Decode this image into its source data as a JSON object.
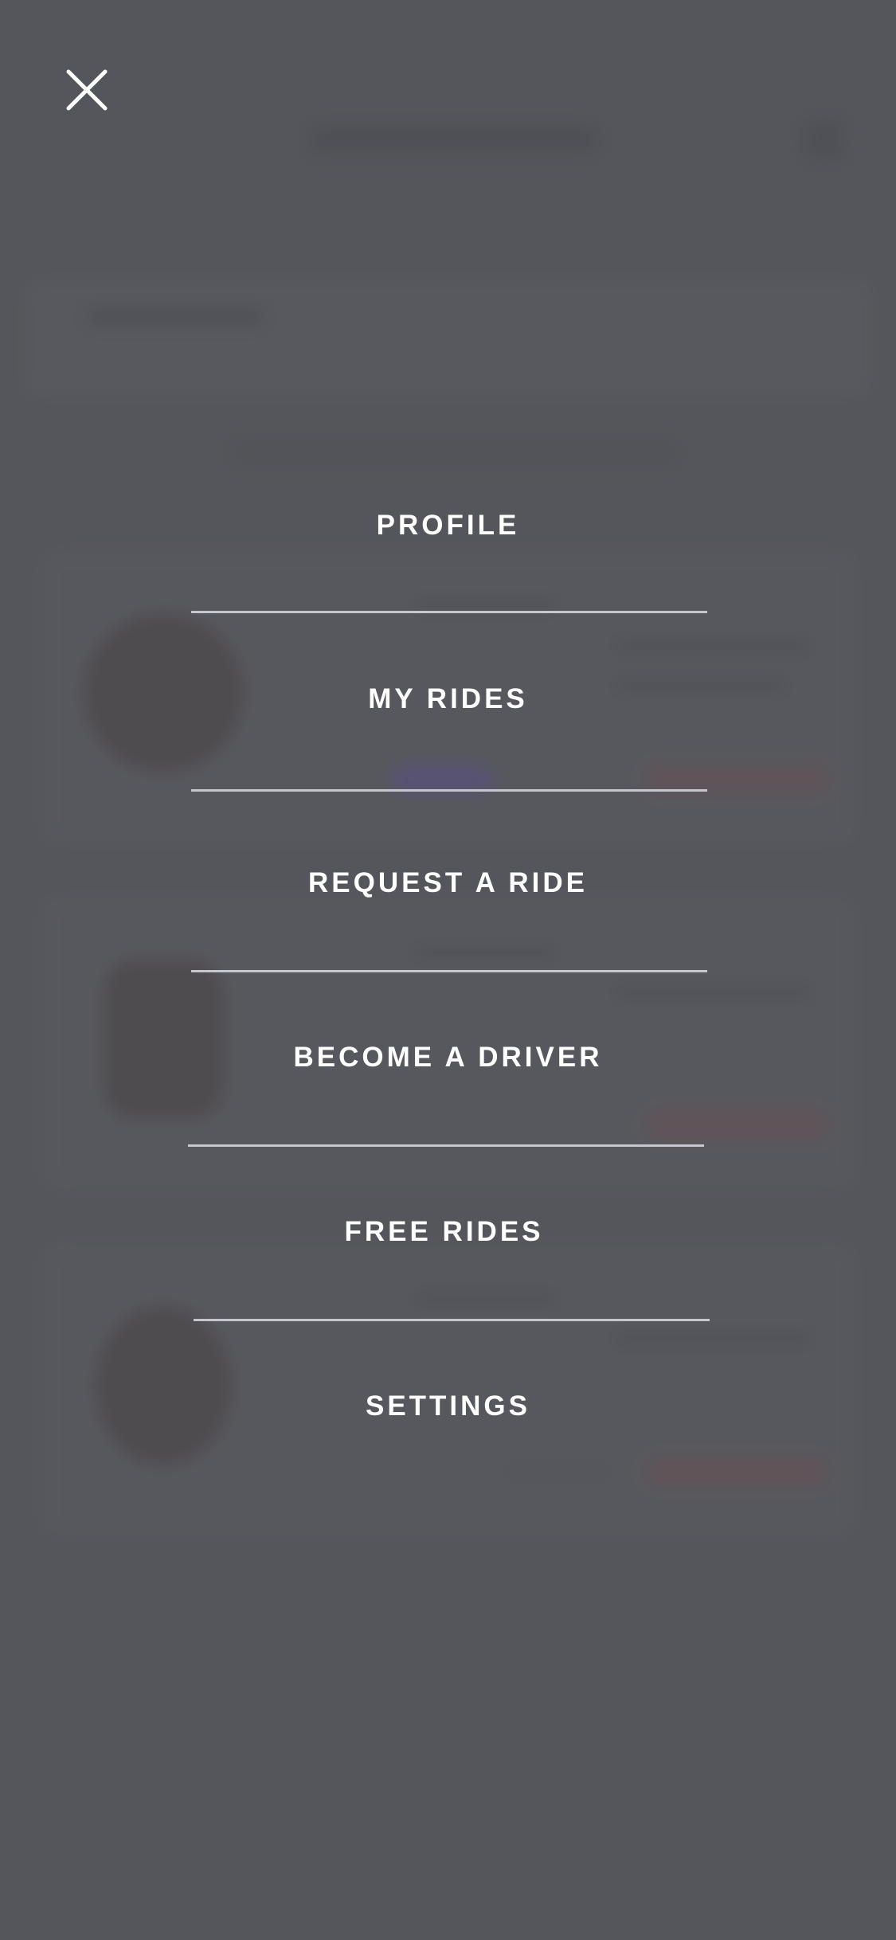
{
  "menu": {
    "items": [
      {
        "label": "PROFILE"
      },
      {
        "label": "MY RIDES"
      },
      {
        "label": "REQUEST A RIDE"
      },
      {
        "label": "BECOME A DRIVER"
      },
      {
        "label": "FREE RIDES"
      },
      {
        "label": "SETTINGS"
      }
    ]
  },
  "icons": {
    "close": "close-icon"
  },
  "colors": {
    "overlay": "#55565b",
    "menu_text": "#ffffff",
    "divider": "#c6c6ce"
  }
}
